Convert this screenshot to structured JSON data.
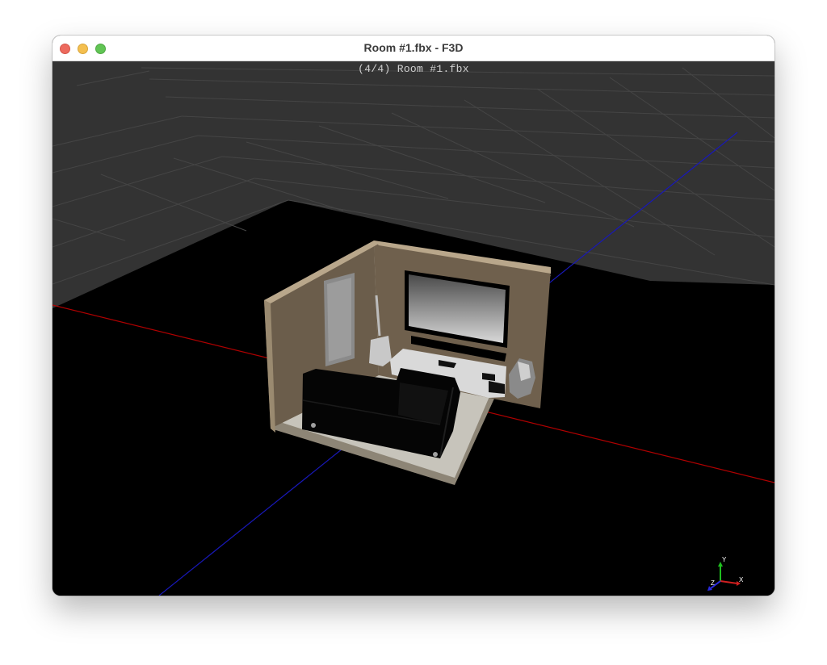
{
  "window": {
    "title": "Room #1.fbx - F3D",
    "buttons": [
      "close",
      "minimize",
      "zoom"
    ]
  },
  "viewport": {
    "file_info": "(4/4) Room #1.fbx",
    "scene_objects": [
      "room-walls",
      "floor",
      "door",
      "guitar",
      "tv",
      "soundbar",
      "tv-stand",
      "sofa",
      "sculpture"
    ],
    "axis_gizmo": {
      "y": "Y",
      "z": "Z",
      "x": "X"
    },
    "colors": {
      "background": "#000000",
      "grid": "#333333",
      "axis_x": "#c00000",
      "axis_z": "#1a1acc",
      "axis_y_gizmo": "#1fbf1f",
      "wall": "#6b5d4b",
      "wall_top": "#b9a78b",
      "floor": "#c7c4bb"
    }
  }
}
